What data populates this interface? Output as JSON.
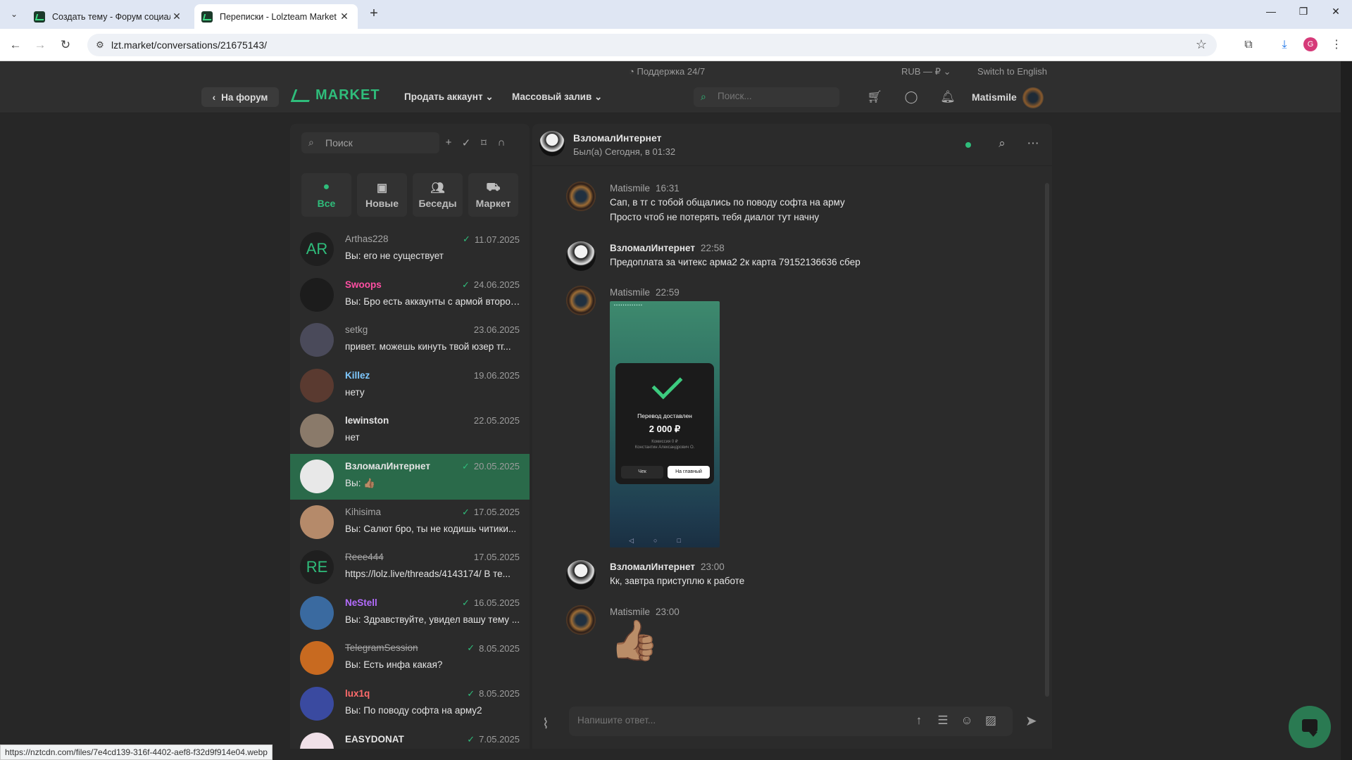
{
  "browser": {
    "tabs": [
      {
        "title": "Создать тему - Форум социал",
        "active": false
      },
      {
        "title": "Переписки - Lolzteam Market",
        "active": true
      }
    ],
    "url": "lzt.market/conversations/21675143/",
    "profile_initial": "G"
  },
  "site": {
    "support": "Поддержка 24/7",
    "currency": "RUB — ₽",
    "switch_language": "Switch to English",
    "back_to_forum": "На форум",
    "logo": "MARKET",
    "menu": [
      "Продать аккаунт",
      "Массовый залив"
    ],
    "search_placeholder": "Поиск...",
    "username": "Matismile"
  },
  "sidebar": {
    "search_placeholder": "Поиск",
    "tabs": [
      {
        "label": "Все",
        "icon": "all-icon",
        "active": true
      },
      {
        "label": "Новые",
        "icon": "new-message-icon",
        "active": false
      },
      {
        "label": "Беседы",
        "icon": "group-icon",
        "active": false
      },
      {
        "label": "Маркет",
        "icon": "market-icon",
        "active": false
      }
    ],
    "conversations": [
      {
        "name": "Arthas228",
        "date": "11.07.2025",
        "preview": "Вы: его не существует",
        "initials": "AR",
        "name_color": "#a6a6a6",
        "bold": false,
        "strike": false,
        "read": true,
        "active": false,
        "avatar_color": "#1f1f1f"
      },
      {
        "name": "Swoops",
        "date": "24.06.2025",
        "preview": "Вы: Бро есть аккаунты с армой второго...",
        "initials": "",
        "name_color": "#ff4fa3",
        "bold": true,
        "strike": false,
        "read": true,
        "active": false,
        "avatar_color": "#1c1c1c"
      },
      {
        "name": "setkg",
        "date": "23.06.2025",
        "preview": "привет. можешь кинуть твой юзер тг...",
        "initials": "",
        "name_color": "#a6a6a6",
        "bold": false,
        "strike": false,
        "read": false,
        "active": false,
        "avatar_color": "#4a4a5a"
      },
      {
        "name": "Killez",
        "date": "19.06.2025",
        "preview": "нету",
        "initials": "",
        "name_color": "#7ec8ff",
        "bold": true,
        "strike": false,
        "read": false,
        "active": false,
        "avatar_color": "#5a3a30"
      },
      {
        "name": "lewinston",
        "date": "22.05.2025",
        "preview": "нет",
        "initials": "",
        "name_color": "#e5e5e5",
        "bold": true,
        "strike": false,
        "read": false,
        "active": false,
        "avatar_color": "#8a7a6a"
      },
      {
        "name": "ВзломалИнтернет",
        "date": "20.05.2025",
        "preview": "Вы: 👍🏽",
        "initials": "",
        "name_color": "#e5e5e5",
        "bold": true,
        "strike": false,
        "read": true,
        "active": true,
        "avatar_color": "#e8e8e8"
      },
      {
        "name": "Kihisima",
        "date": "17.05.2025",
        "preview": "Вы: Салют бро, ты не кодишь читики...",
        "initials": "",
        "name_color": "#a6a6a6",
        "bold": false,
        "strike": false,
        "read": true,
        "active": false,
        "avatar_color": "#b58a6a"
      },
      {
        "name": "Reee444",
        "date": "17.05.2025",
        "preview": "https://lolz.live/threads/4143174/ В те...",
        "initials": "RE",
        "name_color": "#a6a6a6",
        "bold": false,
        "strike": true,
        "read": false,
        "active": false,
        "avatar_color": "#1f1f1f"
      },
      {
        "name": "NeStell",
        "date": "16.05.2025",
        "preview": "Вы: Здравствуйте, увидел вашу тему ...",
        "initials": "",
        "name_color": "#b46cff",
        "bold": true,
        "strike": false,
        "read": true,
        "active": false,
        "avatar_color": "#3a6aa0"
      },
      {
        "name": "TelegramSession",
        "date": "8.05.2025",
        "preview": "Вы: Есть инфа какая?",
        "initials": "",
        "name_color": "#a6a6a6",
        "bold": false,
        "strike": true,
        "read": true,
        "active": false,
        "avatar_color": "#c86a20"
      },
      {
        "name": "lux1q",
        "date": "8.05.2025",
        "preview": "Вы: По поводу софта на арму2",
        "initials": "",
        "name_color": "#ff6b6b",
        "bold": true,
        "strike": false,
        "read": true,
        "active": false,
        "avatar_color": "#3a4aa0"
      },
      {
        "name": "EASYDONAT",
        "date": "7.05.2025",
        "preview": "",
        "initials": "",
        "name_color": "#e5e5e5",
        "bold": true,
        "strike": false,
        "read": true,
        "active": false,
        "avatar_color": "#f0e0e8"
      }
    ]
  },
  "chat": {
    "title": "ВзломалИнтернет",
    "last_seen": "Был(а) Сегодня, в 01:32",
    "messages": [
      {
        "author": "Matismile",
        "time": "16:31",
        "lines": [
          "Сап, в тг с тобой общались по поводу софта на арму",
          "Просто чтоб не потерять тебя диалог тут начну"
        ]
      },
      {
        "author": "ВзломалИнтернет",
        "time": "22:58",
        "lines": [
          "Предоплата за читекс арма2 2к карта 79152136636 сбер"
        ]
      },
      {
        "author": "Matismile",
        "time": "22:59",
        "image": {
          "status": "Перевод доставлен",
          "amount": "2 000 ₽",
          "commission": "Комиссия 0 ₽",
          "recipient": "Константин Александрович О.",
          "btn_receipt": "Чек",
          "btn_main": "На главный"
        }
      },
      {
        "author": "ВзломалИнтернет",
        "time": "23:00",
        "lines": [
          "Кк, завтра приступлю к работе"
        ]
      },
      {
        "author": "Matismile",
        "time": "23:00",
        "emoji": "👍🏽"
      }
    ],
    "composer_placeholder": "Напишите ответ..."
  },
  "status_bar_url": "https://nztcdn.com/files/7e4cd139-316f-4402-aef8-f32d9f914e04.webp",
  "colors": {
    "accent": "#2fbd7b",
    "active_row": "#2a6a4a",
    "background": "#272727"
  }
}
